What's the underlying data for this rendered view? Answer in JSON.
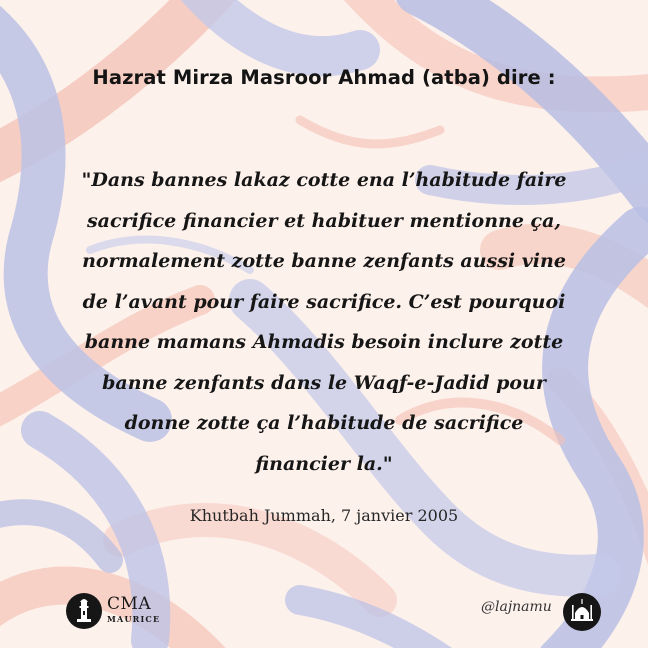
{
  "heading": "Hazrat Mirza Masroor Ahmad (atba) dire :",
  "quote": {
    "lines": [
      "\"Dans bannes lakaz cotte ena l’habitude faire",
      "sacrifice financier et habituer mentionne ça,",
      "normalement zotte banne zenfants aussi vine",
      "de l’avant pour faire sacrifice. C’est pourquoi",
      "banne mamans Ahmadis besoin inclure zotte",
      "banne zenfants dans le Waqf-e-Jadid pour",
      "donne zotte ça l’habitude de sacrifice",
      "financier la.\""
    ]
  },
  "source": "Khutbah Jummah, 7 janvier 2005",
  "footer": {
    "left_logo_icon": "mosque-minaret-icon",
    "org_name": "CMA",
    "org_subtitle": "MAURICE",
    "handle": "@lajnamu",
    "right_logo_icon": "mosque-dome-icon"
  },
  "colors": {
    "background": "#fdf1ec",
    "stroke_blue": "#b9bfe3",
    "stroke_pink": "#f4c6bb",
    "text": "#141414"
  }
}
